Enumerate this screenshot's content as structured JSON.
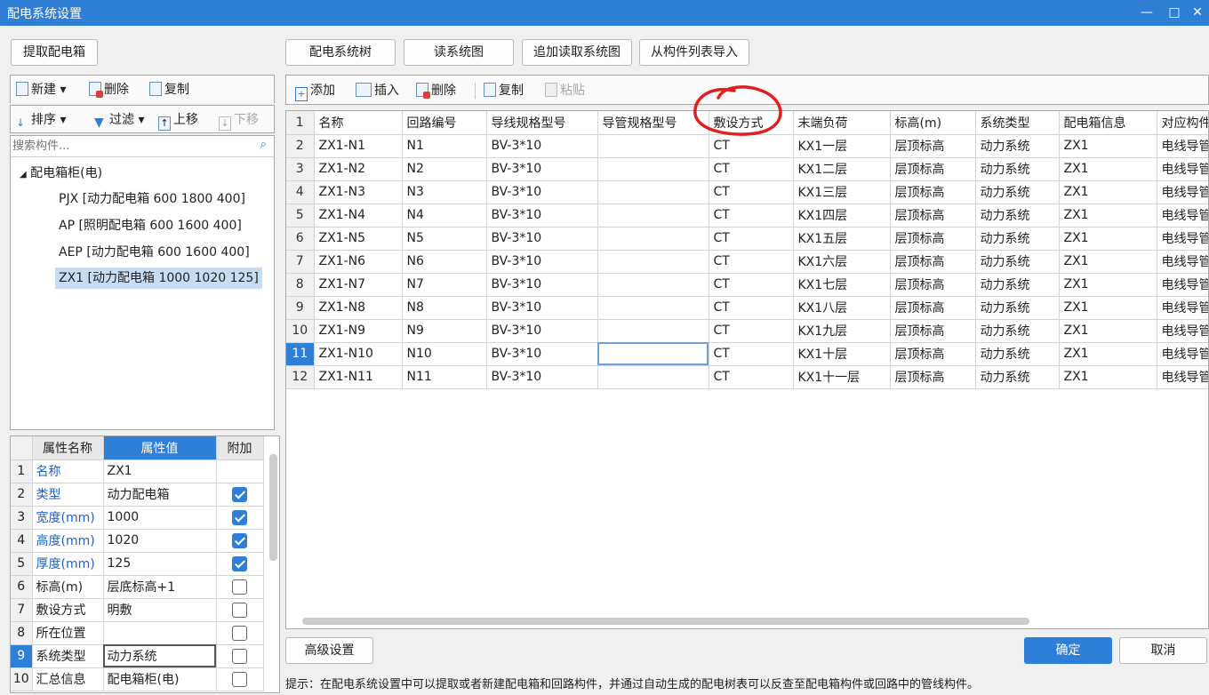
{
  "window": {
    "title": "配电系统设置",
    "minimize": "—",
    "maximize": "□",
    "close": "✕"
  },
  "left": {
    "extract_button": "提取配电箱",
    "toolbar1": {
      "new": "新建",
      "delete": "删除",
      "copy": "复制"
    },
    "toolbar2": {
      "sort": "排序",
      "filter": "过滤",
      "move_up": "上移",
      "move_down": "下移"
    },
    "search_placeholder": "搜索构件...",
    "tree": {
      "root": "配电箱柜(电)",
      "items": [
        "PJX [动力配电箱 600 1800 400]",
        "AP [照明配电箱 600 1600 400]",
        "AEP [动力配电箱 600 1600 400]",
        "ZX1 [动力配电箱 1000 1020 125]"
      ],
      "selected_index": 3
    },
    "props": {
      "headers": {
        "name": "属性名称",
        "value": "属性值",
        "add": "附加"
      },
      "rows": [
        {
          "n": "1",
          "name": "名称",
          "value": "ZX1",
          "cb": null,
          "blue": true
        },
        {
          "n": "2",
          "name": "类型",
          "value": "动力配电箱",
          "cb": true,
          "blue": true
        },
        {
          "n": "3",
          "name": "宽度(mm)",
          "value": "1000",
          "cb": true,
          "blue": true
        },
        {
          "n": "4",
          "name": "高度(mm)",
          "value": "1020",
          "cb": true,
          "blue": true
        },
        {
          "n": "5",
          "name": "厚度(mm)",
          "value": "125",
          "cb": true,
          "blue": true
        },
        {
          "n": "6",
          "name": "标高(m)",
          "value": "层底标高+1",
          "cb": false,
          "blue": false
        },
        {
          "n": "7",
          "name": "敷设方式",
          "value": "明敷",
          "cb": false,
          "blue": false
        },
        {
          "n": "8",
          "name": "所在位置",
          "value": "",
          "cb": false,
          "blue": false
        },
        {
          "n": "9",
          "name": "系统类型",
          "value": "动力系统",
          "cb": false,
          "blue": false
        },
        {
          "n": "10",
          "name": "汇总信息",
          "value": "配电箱柜(电)",
          "cb": false,
          "blue": false
        }
      ],
      "selected_index": 8
    }
  },
  "top_buttons": [
    "配电系统树",
    "读系统图",
    "追加读取系统图",
    "从构件列表导入"
  ],
  "grid_toolbar": {
    "add": "添加",
    "insert": "插入",
    "delete": "删除",
    "copy": "复制",
    "paste": "粘贴"
  },
  "grid": {
    "header_row_number": "1",
    "columns": [
      "名称",
      "回路编号",
      "导线规格型号",
      "导管规格型号",
      "敷设方式",
      "末端负荷",
      "标高(m)",
      "系统类型",
      "配电箱信息",
      "对应构件"
    ],
    "rows": [
      [
        "2",
        "ZX1-N1",
        "N1",
        "BV-3*10",
        "",
        "CT",
        "KX1一层",
        "层顶标高",
        "动力系统",
        "ZX1",
        "电线导管"
      ],
      [
        "3",
        "ZX1-N2",
        "N2",
        "BV-3*10",
        "",
        "CT",
        "KX1二层",
        "层顶标高",
        "动力系统",
        "ZX1",
        "电线导管"
      ],
      [
        "4",
        "ZX1-N3",
        "N3",
        "BV-3*10",
        "",
        "CT",
        "KX1三层",
        "层顶标高",
        "动力系统",
        "ZX1",
        "电线导管"
      ],
      [
        "5",
        "ZX1-N4",
        "N4",
        "BV-3*10",
        "",
        "CT",
        "KX1四层",
        "层顶标高",
        "动力系统",
        "ZX1",
        "电线导管"
      ],
      [
        "6",
        "ZX1-N5",
        "N5",
        "BV-3*10",
        "",
        "CT",
        "KX1五层",
        "层顶标高",
        "动力系统",
        "ZX1",
        "电线导管"
      ],
      [
        "7",
        "ZX1-N6",
        "N6",
        "BV-3*10",
        "",
        "CT",
        "KX1六层",
        "层顶标高",
        "动力系统",
        "ZX1",
        "电线导管"
      ],
      [
        "8",
        "ZX1-N7",
        "N7",
        "BV-3*10",
        "",
        "CT",
        "KX1七层",
        "层顶标高",
        "动力系统",
        "ZX1",
        "电线导管"
      ],
      [
        "9",
        "ZX1-N8",
        "N8",
        "BV-3*10",
        "",
        "CT",
        "KX1八层",
        "层顶标高",
        "动力系统",
        "ZX1",
        "电线导管"
      ],
      [
        "10",
        "ZX1-N9",
        "N9",
        "BV-3*10",
        "",
        "CT",
        "KX1九层",
        "层顶标高",
        "动力系统",
        "ZX1",
        "电线导管"
      ],
      [
        "11",
        "ZX1-N10",
        "N10",
        "BV-3*10",
        "",
        "CT",
        "KX1十层",
        "层顶标高",
        "动力系统",
        "ZX1",
        "电线导管"
      ],
      [
        "12",
        "ZX1-N11",
        "N11",
        "BV-3*10",
        "",
        "CT",
        "KX1十一层",
        "层顶标高",
        "动力系统",
        "ZX1",
        "电线导管"
      ]
    ],
    "selected_row_index": 9,
    "current_col_index": 3
  },
  "bottom": {
    "advanced_button": "高级设置",
    "ok_button": "确定",
    "cancel_button": "取消",
    "hint": "提示：在配电系统设置中可以提取或者新建配电箱和回路构件，并通过自动生成的配电树表可以反查至配电箱构件或回路中的管线构件。"
  },
  "colors": {
    "accent": "#2f7fd6",
    "annotation_red": "#e02020"
  }
}
